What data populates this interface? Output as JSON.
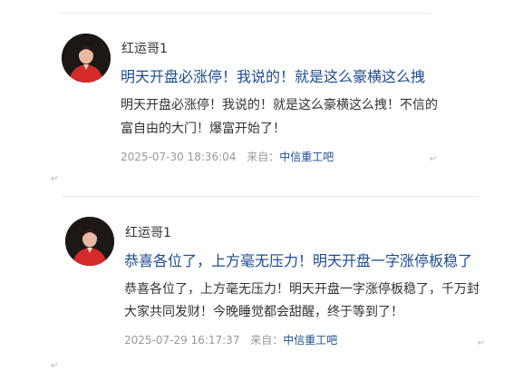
{
  "posts": [
    {
      "username": "红运哥1",
      "title": "明天开盘必涨停！我说的！就是这么豪横这么拽",
      "body_line1": "明天开盘必涨停！我说的！就是这么豪横这么拽！不信的",
      "body_line2": "富自由的大门！爆富开始了！",
      "timestamp": "2025-07-30 18:36:04",
      "source_label": "来自：",
      "forum": "中信重工吧"
    },
    {
      "username": "红运哥1",
      "title": "恭喜各位了，上方毫无压力！明天开盘一字涨停板稳了",
      "body_line1": "恭喜各位了，上方毫无压力！明天开盘一字涨停板稳了，千万封",
      "body_line2": "大家共同发财！今晚睡觉都会甜醒，终于等到了！",
      "timestamp": "2025-07-29 16:17:37",
      "source_label": "来自：",
      "forum": "中信重工吧"
    }
  ],
  "return_mark": "↵"
}
